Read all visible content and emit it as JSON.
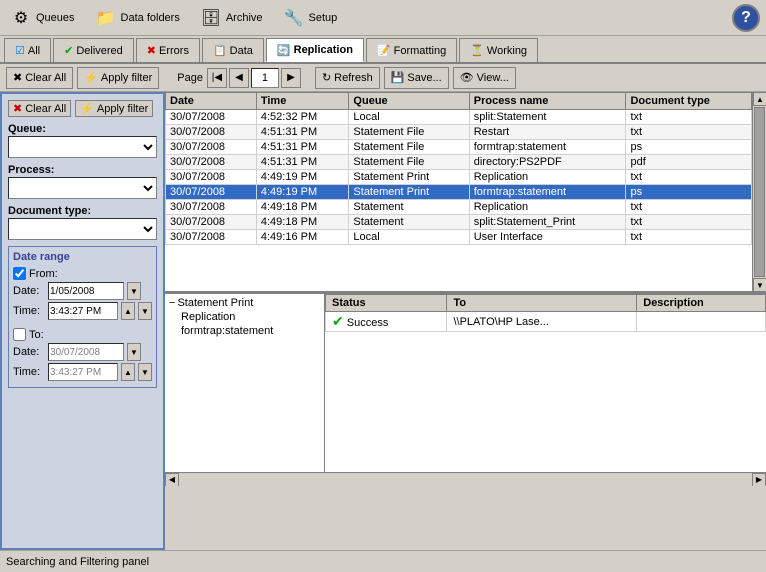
{
  "toolbar": {
    "items": [
      {
        "id": "queues",
        "label": "Queues",
        "icon": "⚙"
      },
      {
        "id": "data-folders",
        "label": "Data folders",
        "icon": "📁"
      },
      {
        "id": "archive",
        "label": "Archive",
        "icon": "🗄"
      },
      {
        "id": "setup",
        "label": "Setup",
        "icon": "🔧"
      }
    ],
    "help_icon": "?"
  },
  "tabs": [
    {
      "id": "all",
      "label": "All",
      "icon": "☑",
      "active": false
    },
    {
      "id": "delivered",
      "label": "Delivered",
      "icon": "✔",
      "active": false
    },
    {
      "id": "errors",
      "label": "Errors",
      "icon": "✖",
      "active": false
    },
    {
      "id": "data",
      "label": "Data",
      "icon": "📋",
      "active": false
    },
    {
      "id": "replication",
      "label": "Replication",
      "icon": "🔄",
      "active": true
    },
    {
      "id": "formatting",
      "label": "Formatting",
      "icon": "📝",
      "active": false
    },
    {
      "id": "working",
      "label": "Working",
      "icon": "⏳",
      "active": false
    }
  ],
  "action_bar": {
    "clear_all": "Clear All",
    "apply_filter": "Apply filter",
    "page_label": "Page",
    "page_num": "1",
    "refresh": "Refresh",
    "save": "Save...",
    "view": "View..."
  },
  "filter_panel": {
    "queue_label": "Queue:",
    "process_label": "Process:",
    "doc_type_label": "Document type:",
    "date_range_title": "Date range",
    "from_label": "From:",
    "from_date": "1/05/2008",
    "from_time": "3:43:27 PM",
    "to_label": "To:",
    "to_date": "30/07/2008",
    "to_time": "3:43:27 PM"
  },
  "log_table": {
    "columns": [
      "Date",
      "Time",
      "Queue",
      "Process name",
      "Document type"
    ],
    "rows": [
      {
        "date": "30/07/2008",
        "time": "4:52:32 PM",
        "queue": "Local",
        "process": "split:Statement",
        "doc_type": "txt",
        "selected": false
      },
      {
        "date": "30/07/2008",
        "time": "4:51:31 PM",
        "queue": "Statement File",
        "process": "Restart",
        "doc_type": "txt",
        "selected": false
      },
      {
        "date": "30/07/2008",
        "time": "4:51:31 PM",
        "queue": "Statement File",
        "process": "formtrap:statement",
        "doc_type": "ps",
        "selected": false
      },
      {
        "date": "30/07/2008",
        "time": "4:51:31 PM",
        "queue": "Statement File",
        "process": "directory:PS2PDF",
        "doc_type": "pdf",
        "selected": false
      },
      {
        "date": "30/07/2008",
        "time": "4:49:19 PM",
        "queue": "Statement Print",
        "process": "Replication",
        "doc_type": "txt",
        "selected": false
      },
      {
        "date": "30/07/2008",
        "time": "4:49:19 PM",
        "queue": "Statement Print",
        "process": "formtrap:statement",
        "doc_type": "ps",
        "selected": true
      },
      {
        "date": "30/07/2008",
        "time": "4:49:18 PM",
        "queue": "Statement",
        "process": "Replication",
        "doc_type": "txt",
        "selected": false
      },
      {
        "date": "30/07/2008",
        "time": "4:49:18 PM",
        "queue": "Statement",
        "process": "split:Statement_Print",
        "doc_type": "txt",
        "selected": false
      },
      {
        "date": "30/07/2008",
        "time": "4:49:16 PM",
        "queue": "Local",
        "process": "User Interface",
        "doc_type": "txt",
        "selected": false
      }
    ]
  },
  "tree_panel": {
    "items": [
      {
        "label": "Statement Print",
        "indent": 0,
        "icon": "−"
      },
      {
        "label": "Replication",
        "indent": 1,
        "icon": ""
      },
      {
        "label": "formtrap:statement",
        "indent": 1,
        "icon": ""
      }
    ]
  },
  "detail_table": {
    "columns": [
      "Status",
      "To",
      "Description"
    ],
    "rows": [
      {
        "status": "Success",
        "status_icon": "✔",
        "to": "\\\\PLATO\\HP Lase...",
        "description": ""
      }
    ]
  },
  "status_bar": {
    "text": "Searching and Filtering panel"
  },
  "colors": {
    "selected_row_bg": "#316ac5",
    "selected_row_text": "#ffffff",
    "panel_bg": "#cdd3e0",
    "panel_border": "#6080b0",
    "toolbar_bg": "#d4d0c8"
  }
}
